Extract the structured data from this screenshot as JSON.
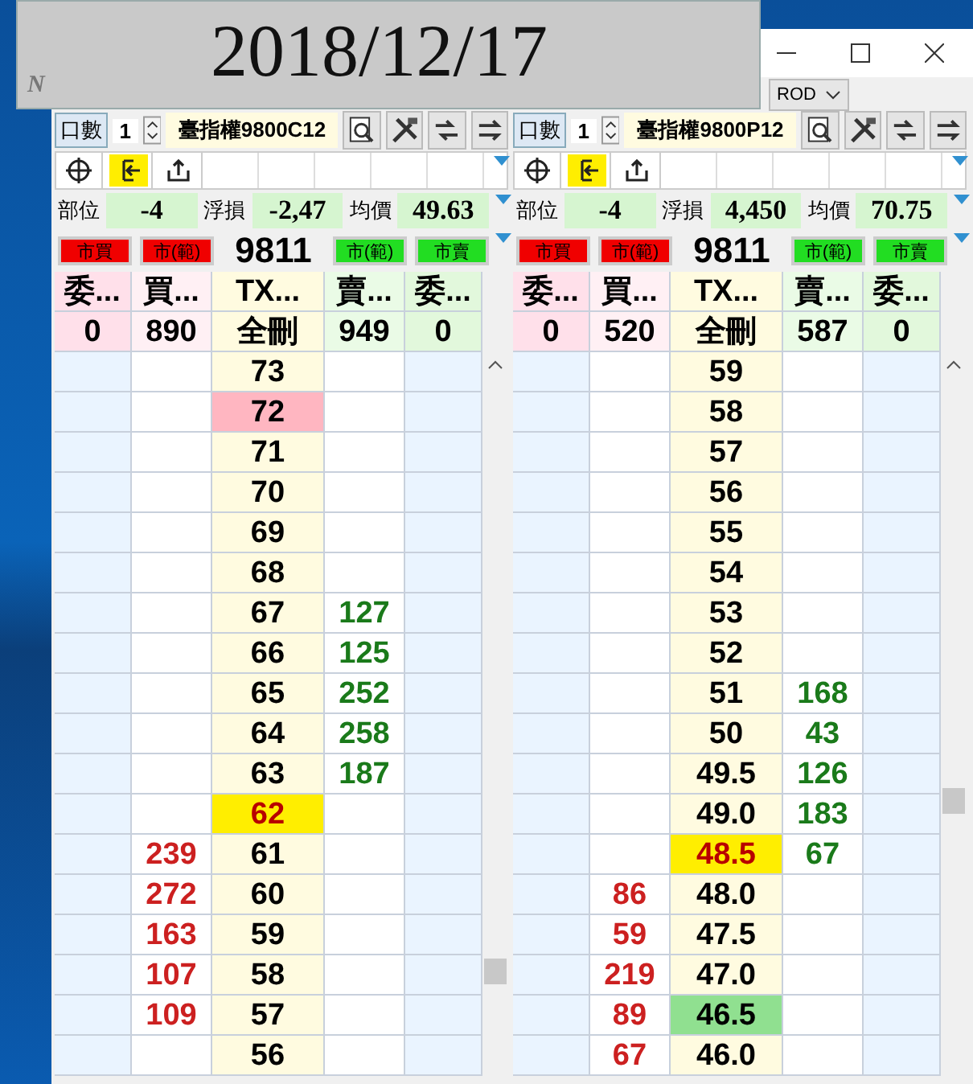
{
  "banner": {
    "date": "2018/12/17",
    "mark": "N"
  },
  "window": {
    "order_type": "ROD"
  },
  "panels": [
    {
      "qty_label": "口數",
      "qty": "1",
      "contract": "臺指權9800C12",
      "stats": [
        {
          "label": "部位",
          "value": "-4"
        },
        {
          "label": "浮損",
          "value": "-2,47"
        },
        {
          "label": "均價",
          "value": "49.63"
        }
      ],
      "buttons": [
        {
          "label": "市買",
          "kind": "buy"
        },
        {
          "label": "市(範)",
          "kind": "buy"
        },
        {
          "label": "9811",
          "kind": "price"
        },
        {
          "label": "市(範)",
          "kind": "sell"
        },
        {
          "label": "市賣",
          "kind": "sell"
        }
      ],
      "columns": [
        "委...",
        "買...",
        "TX...",
        "賣...",
        "委..."
      ],
      "totals": [
        "0",
        "890",
        "全刪",
        "949",
        "0"
      ],
      "rows": [
        {
          "price": "73",
          "last": false
        },
        {
          "price": "72",
          "last": false,
          "color": "#ffb6c1"
        },
        {
          "price": "71",
          "last": false
        },
        {
          "price": "70",
          "last": false
        },
        {
          "price": "69",
          "last": false
        },
        {
          "price": "68",
          "last": false
        },
        {
          "price": "67",
          "ask": "127",
          "last": false
        },
        {
          "price": "66",
          "ask": "125",
          "last": false
        },
        {
          "price": "65",
          "ask": "252",
          "last": false
        },
        {
          "price": "64",
          "ask": "258",
          "last": false
        },
        {
          "price": "63",
          "ask": "187",
          "last": false
        },
        {
          "price": "62",
          "last": true,
          "color": "#ffee00"
        },
        {
          "bid": "239",
          "price": "61",
          "last": false
        },
        {
          "bid": "272",
          "price": "60",
          "last": false
        },
        {
          "bid": "163",
          "price": "59",
          "last": false
        },
        {
          "bid": "107",
          "price": "58",
          "last": false
        },
        {
          "bid": "109",
          "price": "57",
          "last": false
        },
        {
          "price": "56",
          "last": false
        }
      ]
    },
    {
      "qty_label": "口數",
      "qty": "1",
      "contract": "臺指權9800P12",
      "stats": [
        {
          "label": "部位",
          "value": "-4"
        },
        {
          "label": "浮損",
          "value": "4,450"
        },
        {
          "label": "均價",
          "value": "70.75"
        }
      ],
      "buttons": [
        {
          "label": "市買",
          "kind": "buy"
        },
        {
          "label": "市(範)",
          "kind": "buy"
        },
        {
          "label": "9811",
          "kind": "price"
        },
        {
          "label": "市(範)",
          "kind": "sell"
        },
        {
          "label": "市賣",
          "kind": "sell"
        }
      ],
      "columns": [
        "委...",
        "買...",
        "TX...",
        "賣...",
        "委..."
      ],
      "totals": [
        "0",
        "520",
        "全刪",
        "587",
        "0"
      ],
      "rows": [
        {
          "price": "59",
          "last": false
        },
        {
          "price": "58",
          "last": false
        },
        {
          "price": "57",
          "last": false
        },
        {
          "price": "56",
          "last": false
        },
        {
          "price": "55",
          "last": false
        },
        {
          "price": "54",
          "last": false
        },
        {
          "price": "53",
          "last": false
        },
        {
          "price": "52",
          "last": false
        },
        {
          "price": "51",
          "ask": "168",
          "last": false
        },
        {
          "price": "50",
          "ask": "43",
          "last": false
        },
        {
          "price": "49.5",
          "ask": "126",
          "last": false
        },
        {
          "price": "49.0",
          "ask": "183",
          "last": false
        },
        {
          "price": "48.5",
          "ask": "67",
          "last": true,
          "color": "#ffee00"
        },
        {
          "bid": "86",
          "price": "48.0",
          "last": false
        },
        {
          "bid": "59",
          "price": "47.5",
          "last": false
        },
        {
          "bid": "219",
          "price": "47.0",
          "last": false
        },
        {
          "bid": "89",
          "price": "46.5",
          "last": false,
          "color": "#90e090"
        },
        {
          "bid": "67",
          "price": "46.0",
          "last": false
        }
      ]
    }
  ]
}
